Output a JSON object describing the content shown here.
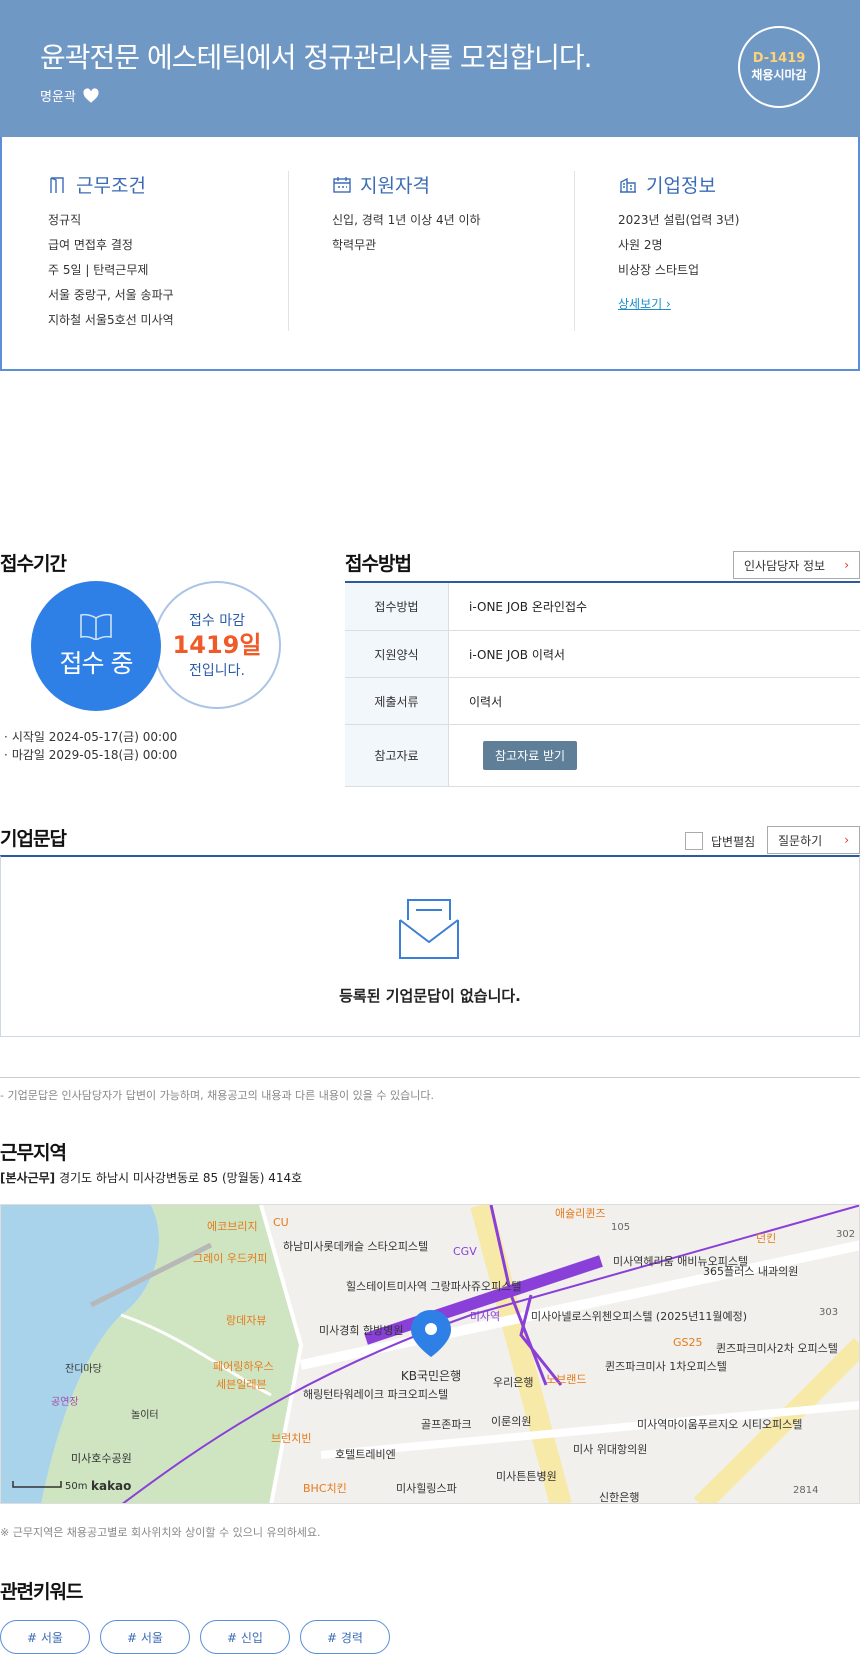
{
  "header": {
    "title": "윤곽전문 에스테틱에서 정규관리사를 모집합니다.",
    "company": "명윤곽",
    "dday": "D-1419",
    "deadline_type": "채용시마감"
  },
  "summary": {
    "conditions": {
      "title": "근무조건",
      "lines": [
        "정규직",
        "급여 면접후 결정",
        "주 5일 | 탄력근무제",
        "서울 중랑구, 서울 송파구",
        "지하철 서울5호선 미사역"
      ]
    },
    "qualifications": {
      "title": "지원자격",
      "lines": [
        "신입, 경력 1년 이상 4년 이하",
        "학력무관"
      ]
    },
    "company": {
      "title": "기업정보",
      "lines": [
        "2023년 설립(업력 3년)",
        "사원 2명",
        "비상장 스타트업"
      ],
      "more": "상세보기"
    }
  },
  "period": {
    "title": "접수기간",
    "status": "접수 중",
    "countdown_prefix": "접수 마감",
    "countdown_value": "1419일",
    "countdown_suffix": "전입니다.",
    "start": "시작일 2024-05-17(금) 00:00",
    "end": "마감일 2029-05-18(금) 00:00"
  },
  "method": {
    "title": "접수방법",
    "hr_button": "인사담당자 정보",
    "rows": [
      {
        "key": "접수방법",
        "value": "i-ONE JOB 온라인접수"
      },
      {
        "key": "지원양식",
        "value": "i-ONE JOB 이력서"
      },
      {
        "key": "제출서류",
        "value": "이력서"
      },
      {
        "key": "참고자료",
        "button": "참고자료 받기"
      }
    ]
  },
  "qa": {
    "title": "기업문답",
    "toggle_label": "답변펼침",
    "ask_button": "질문하기",
    "empty_text": "등록된 기업문답이 없습니다.",
    "note": "- 기업문답은 인사담당자가 답변이 가능하며, 채용공고의 내용과 다른 내용이 있을 수 있습니다."
  },
  "area": {
    "title": "근무지역",
    "address_tag": "[본사근무]",
    "address": "경기도 하남시 미사강변동로 85 (망월동) 414호",
    "map_note": "※ 근무지역은 채용공고별로 회사위치와 상이할 수 있으니 유의하세요.",
    "map_labels": {
      "center": "KB국민은행",
      "station": "미사역",
      "scale": "50m",
      "brand": "kakao",
      "places": [
        "에코브리지",
        "CU",
        "그레이 우드커피",
        "하남미사롯데캐슬 스타오피스텔",
        "힐스테이트미사역 그랑파사쥬오피스텔",
        "CGV",
        "애슐리퀸즈",
        "미사역헤리움 애비뉴오피스텔",
        "365플러스 내과의원",
        "던킨",
        "랑데자뷰",
        "미사경희 한방병원",
        "미사아넬로스위첸오피스텔 (2025년11월예정)",
        "GS25",
        "퀸즈파크미사2차 오피스텔",
        "페어링하우스",
        "세븐일레븐",
        "해링턴타워레이크 파크오피스텔",
        "우리은행",
        "퀸즈파크미사 1차오피스텔",
        "잔디마당",
        "공연장",
        "놀이터",
        "골프존파크",
        "이룬의원",
        "미사 위대항의원",
        "미사역마이움푸르지오 시티오피스텔",
        "브런치빈",
        "호텔트레비엔",
        "미사호수공원",
        "BHC치킨",
        "미사힐링스파",
        "미사튼튼병원",
        "신한은행",
        "노브랜드",
        "105",
        "302",
        "303",
        "2814"
      ]
    }
  },
  "keywords": {
    "title": "관련키워드",
    "items": [
      "# 서울",
      "# 서울",
      "# 신입",
      "# 경력"
    ]
  },
  "colors": {
    "header_bg": "#7098c4",
    "accent_blue": "#2f80e6",
    "deadline_orange": "#f05a28",
    "border_blue": "#2c5aa0"
  }
}
